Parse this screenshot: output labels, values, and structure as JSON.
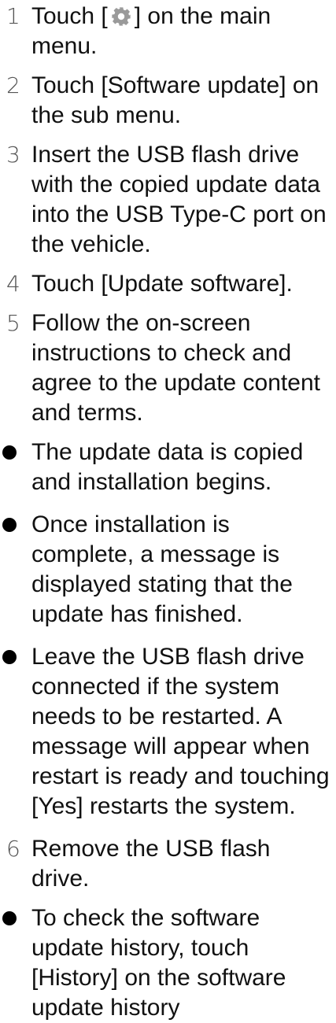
{
  "steps": [
    {
      "number": "1",
      "text_before": "Touch [",
      "icon": "gear-icon",
      "icon_color": "#9a9a9a",
      "text_after": "] on the main menu."
    },
    {
      "number": "2",
      "text": "Touch [Software update] on the sub menu."
    },
    {
      "number": "3",
      "text": "Insert the USB flash drive with the copied update data into the USB Type-C port on the vehicle."
    },
    {
      "number": "4",
      "text": "Touch [Update software]."
    },
    {
      "number": "5",
      "text": "Follow the on-screen instructions to check and agree to the update content and terms."
    },
    {
      "number": "6",
      "text": "Remove the USB flash drive."
    }
  ],
  "notes_after_step5": [
    "The update data is copied and installation begins.",
    "Once installation is complete, a message is displayed stating that the update has finished.",
    "Leave the USB flash drive connected if the system needs to be restarted. A message will appear when restart is ready and touching [Yes] restarts the system."
  ],
  "notes_after_step6": [
    "To check the software update history, touch [History] on the software update history"
  ]
}
